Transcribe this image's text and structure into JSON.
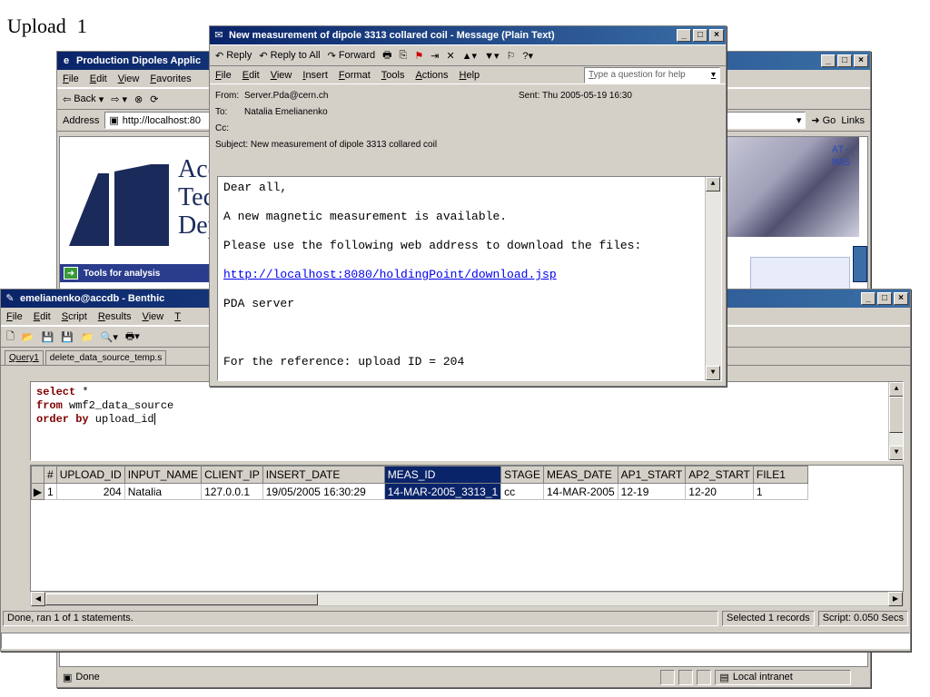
{
  "caption": {
    "word": "Upload",
    "number": "1"
  },
  "ie": {
    "title": "Production Dipoles Applic",
    "menu": [
      "File",
      "Edit",
      "View",
      "Favorites"
    ],
    "toolbar": {
      "back": "Back"
    },
    "address_label": "Address",
    "address_value": "http://localhost:80",
    "go": "Go",
    "links": "Links",
    "dept_lines": [
      "Acc",
      "Tec",
      "Dep"
    ],
    "right_text": [
      "AT-",
      "MAS"
    ],
    "tools_label": "Tools for analysis",
    "status_done": "Done",
    "status_zone": "Local intranet"
  },
  "bq": {
    "title": "emelianenko@accdb - Benthic",
    "menu": [
      "File",
      "Edit",
      "Script",
      "Results",
      "View",
      "T"
    ],
    "tabs": [
      "Query1",
      "delete_data_source_temp.s"
    ],
    "sql": [
      {
        "kw": "select",
        "rest": " *"
      },
      {
        "kw": "from",
        "rest": " wmf2_data_source"
      },
      {
        "kw": "order by",
        "rest": " upload_id"
      }
    ],
    "columns": [
      "#",
      "UPLOAD_ID",
      "INPUT_NAME",
      "CLIENT_IP",
      "INSERT_DATE",
      "MEAS_ID",
      "STAGE",
      "MEAS_DATE",
      "AP1_START",
      "AP2_START",
      "FILE1"
    ],
    "rows": [
      [
        "1",
        "204",
        "Natalia",
        "127.0.0.1",
        "19/05/2005 16:30:29",
        "14-MAR-2005_3313_1",
        "cc",
        "14-MAR-2005",
        "12-19",
        "12-20",
        "1"
      ]
    ],
    "status_left": "Done, ran 1 of 1 statements.",
    "status_sel": "Selected 1 records",
    "status_script": "Script: 0.050 Secs"
  },
  "msg": {
    "title": "New measurement of dipole 3313 collared coil - Message (Plain Text)",
    "toolbar": {
      "reply": "Reply",
      "reply_all": "Reply to All",
      "forward": "Forward"
    },
    "menu": [
      "File",
      "Edit",
      "View",
      "Insert",
      "Format",
      "Tools",
      "Actions",
      "Help"
    ],
    "help_placeholder": "Type a question for help",
    "from_label": "From:",
    "from": "Server.Pda@cern.ch",
    "to_label": "To:",
    "to": "Natalia Emelianenko",
    "cc_label": "Cc:",
    "subject_label": "Subject:",
    "subject": "New measurement of dipole 3313 collared coil",
    "sent_label": "Sent:",
    "sent": "Thu 2005-05-19 16:30",
    "body": [
      "Dear all,",
      "A new magnetic measurement is available.",
      "Please use the following web address to download the files:",
      "http://localhost:8080/holdingPoint/download.jsp",
      "PDA server",
      "",
      "For the reference: upload ID = 204"
    ]
  }
}
